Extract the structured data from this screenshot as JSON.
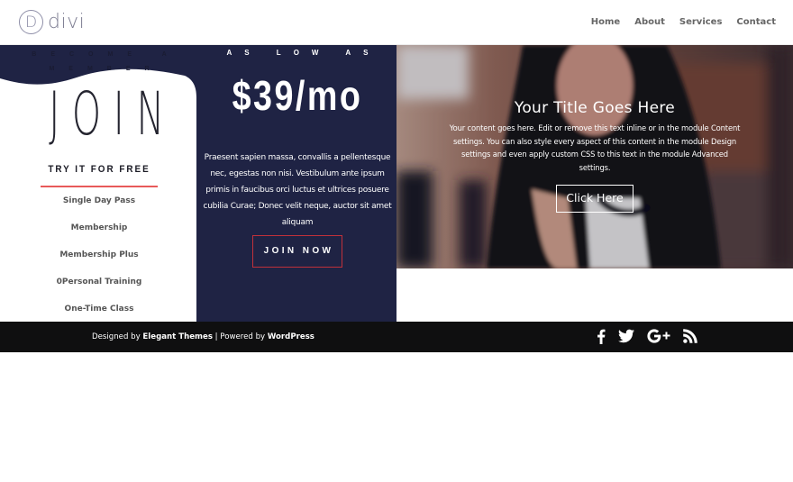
{
  "header": {
    "logo_letter": "D",
    "logo_text": "divi",
    "nav": [
      "Home",
      "About",
      "Services",
      "Contact"
    ]
  },
  "left": {
    "eyebrow_line1": "BECOME A",
    "eyebrow_line2": "MEMBER",
    "heading": "JOIN",
    "subheading": "TRY IT FOR FREE",
    "plans": [
      "Single Day Pass",
      "Membership",
      "Membership Plus",
      "0Personal Training",
      "One-Time Class"
    ]
  },
  "middle": {
    "eyebrow": "AS LOW AS",
    "price": "$39/mo",
    "body": "Praesent sapien massa, convallis a pellentesque nec, egestas non nisi. Vestibulum ante ipsum primis in faucibus orci luctus et ultrices posuere cubilia Curae; Donec velit neque, auctor sit amet aliquam",
    "button": "JOIN NOW"
  },
  "hero": {
    "title": "Your Title Goes Here",
    "body": "Your content goes here. Edit or remove this text inline or in the module Content settings. You can also style every aspect of this content in the module Design settings and even apply custom CSS to this text in the module Advanced settings.",
    "button": "Click Here"
  },
  "footer": {
    "designed_by": "Designed by ",
    "designer": "Elegant Themes",
    "separator": " | Powered by ",
    "platform": "WordPress",
    "social": [
      "facebook-icon",
      "twitter-icon",
      "google-plus-icon",
      "rss-icon"
    ]
  },
  "colors": {
    "navy": "#1f2344",
    "accent_red": "#e85a5a",
    "button_border_red": "#c0303a",
    "footer_bg": "#0f0f10"
  }
}
